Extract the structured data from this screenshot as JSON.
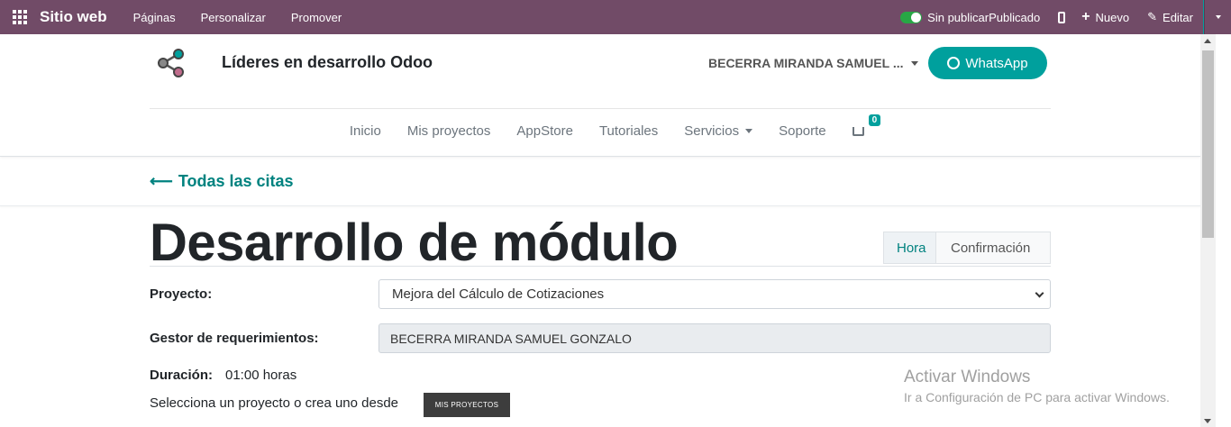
{
  "topbar": {
    "brand": "Sitio web",
    "menus": [
      "Páginas",
      "Personalizar",
      "Promover"
    ],
    "publish_status": "Sin publicarPublicado",
    "new_label": "Nuevo",
    "edit_label": "Editar",
    "accent_color": "#714b67"
  },
  "header": {
    "site_name": "Líderes en desarrollo Odoo",
    "user_name": "BECERRA MIRANDA SAMUEL ...",
    "whatsapp_label": "WhatsApp",
    "whatsapp_color": "#00a09d"
  },
  "nav": {
    "items": [
      "Inicio",
      "Mis proyectos",
      "AppStore",
      "Tutoriales",
      "Servicios",
      "Soporte"
    ],
    "cart_count": "0"
  },
  "back": {
    "label": "Todas las citas"
  },
  "main": {
    "title": "Desarrollo de módulo",
    "steps": [
      "Hora",
      "Confirmación"
    ],
    "project_label": "Proyecto:",
    "project_value": "Mejora del Cálculo de Cotizaciones",
    "manager_label": "Gestor de requerimientos:",
    "manager_value": "BECERRA MIRANDA SAMUEL GONZALO",
    "duration_label": "Duración:",
    "duration_value": "01:00 horas",
    "select_text": "Selecciona un proyecto o crea uno desde",
    "projects_button": "MIS PROYECTOS"
  },
  "watermark": {
    "title": "Activar Windows",
    "subtitle": "Ir a Configuración de PC para activar Windows."
  }
}
